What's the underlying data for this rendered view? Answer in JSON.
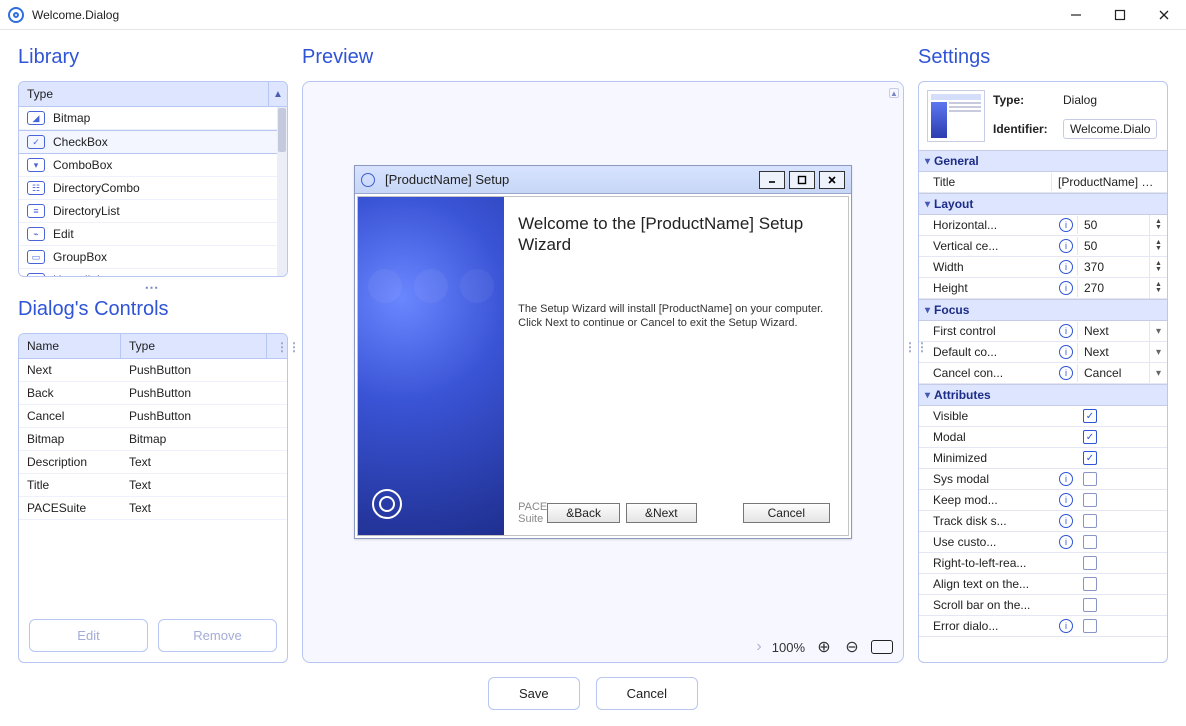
{
  "window": {
    "title": "Welcome.Dialog"
  },
  "library": {
    "title": "Library",
    "header": "Type",
    "items": [
      {
        "label": "Bitmap"
      },
      {
        "label": "CheckBox",
        "selected": true
      },
      {
        "label": "ComboBox"
      },
      {
        "label": "DirectoryCombo"
      },
      {
        "label": "DirectoryList"
      },
      {
        "label": "Edit"
      },
      {
        "label": "GroupBox"
      },
      {
        "label": "Hyperlink"
      }
    ]
  },
  "dialog_controls": {
    "title": "Dialog's Controls",
    "headers": {
      "name": "Name",
      "type": "Type"
    },
    "rows": [
      {
        "name": "Next",
        "type": "PushButton"
      },
      {
        "name": "Back",
        "type": "PushButton"
      },
      {
        "name": "Cancel",
        "type": "PushButton"
      },
      {
        "name": "Bitmap",
        "type": "Bitmap"
      },
      {
        "name": "Description",
        "type": "Text"
      },
      {
        "name": "Title",
        "type": "Text"
      },
      {
        "name": "PACESuite",
        "type": "Text"
      }
    ],
    "buttons": {
      "edit": "Edit",
      "remove": "Remove"
    }
  },
  "preview": {
    "title": "Preview",
    "dialog": {
      "titlebar": "[ProductName] Setup",
      "heading": "Welcome to the [ProductName] Setup Wizard",
      "body": "The Setup Wizard will install [ProductName] on your computer. Click Next to continue or Cancel to exit the Setup Wizard.",
      "brand": "PACE Suite",
      "buttons": {
        "back": "&Back",
        "next": "&Next",
        "cancel": "Cancel"
      }
    },
    "zoom": "100%"
  },
  "settings": {
    "title": "Settings",
    "type_label": "Type:",
    "type_value": "Dialog",
    "identifier_label": "Identifier:",
    "identifier_value": "Welcome.Dialo",
    "groups": {
      "general": {
        "label": "General",
        "title_label": "Title",
        "title_value": "[ProductName] Setup"
      },
      "layout": {
        "label": "Layout",
        "hcenter_label": "Horizontal...",
        "hcenter_value": "50",
        "vcenter_label": "Vertical ce...",
        "vcenter_value": "50",
        "width_label": "Width",
        "width_value": "370",
        "height_label": "Height",
        "height_value": "270"
      },
      "focus": {
        "label": "Focus",
        "first_label": "First control",
        "first_value": "Next",
        "default_label": "Default co...",
        "default_value": "Next",
        "cancel_label": "Cancel con...",
        "cancel_value": "Cancel"
      },
      "attributes": {
        "label": "Attributes",
        "visible": "Visible",
        "modal": "Modal",
        "minimized": "Minimized",
        "sysmodal": "Sys modal",
        "keepmod": "Keep mod...",
        "trackdisk": "Track disk s...",
        "usecusto": "Use custo...",
        "rtl": "Right-to-left-rea...",
        "align": "Align text on the...",
        "scroll": "Scroll bar on the...",
        "errordlg": "Error dialo..."
      }
    }
  },
  "bottom": {
    "save": "Save",
    "cancel": "Cancel"
  }
}
